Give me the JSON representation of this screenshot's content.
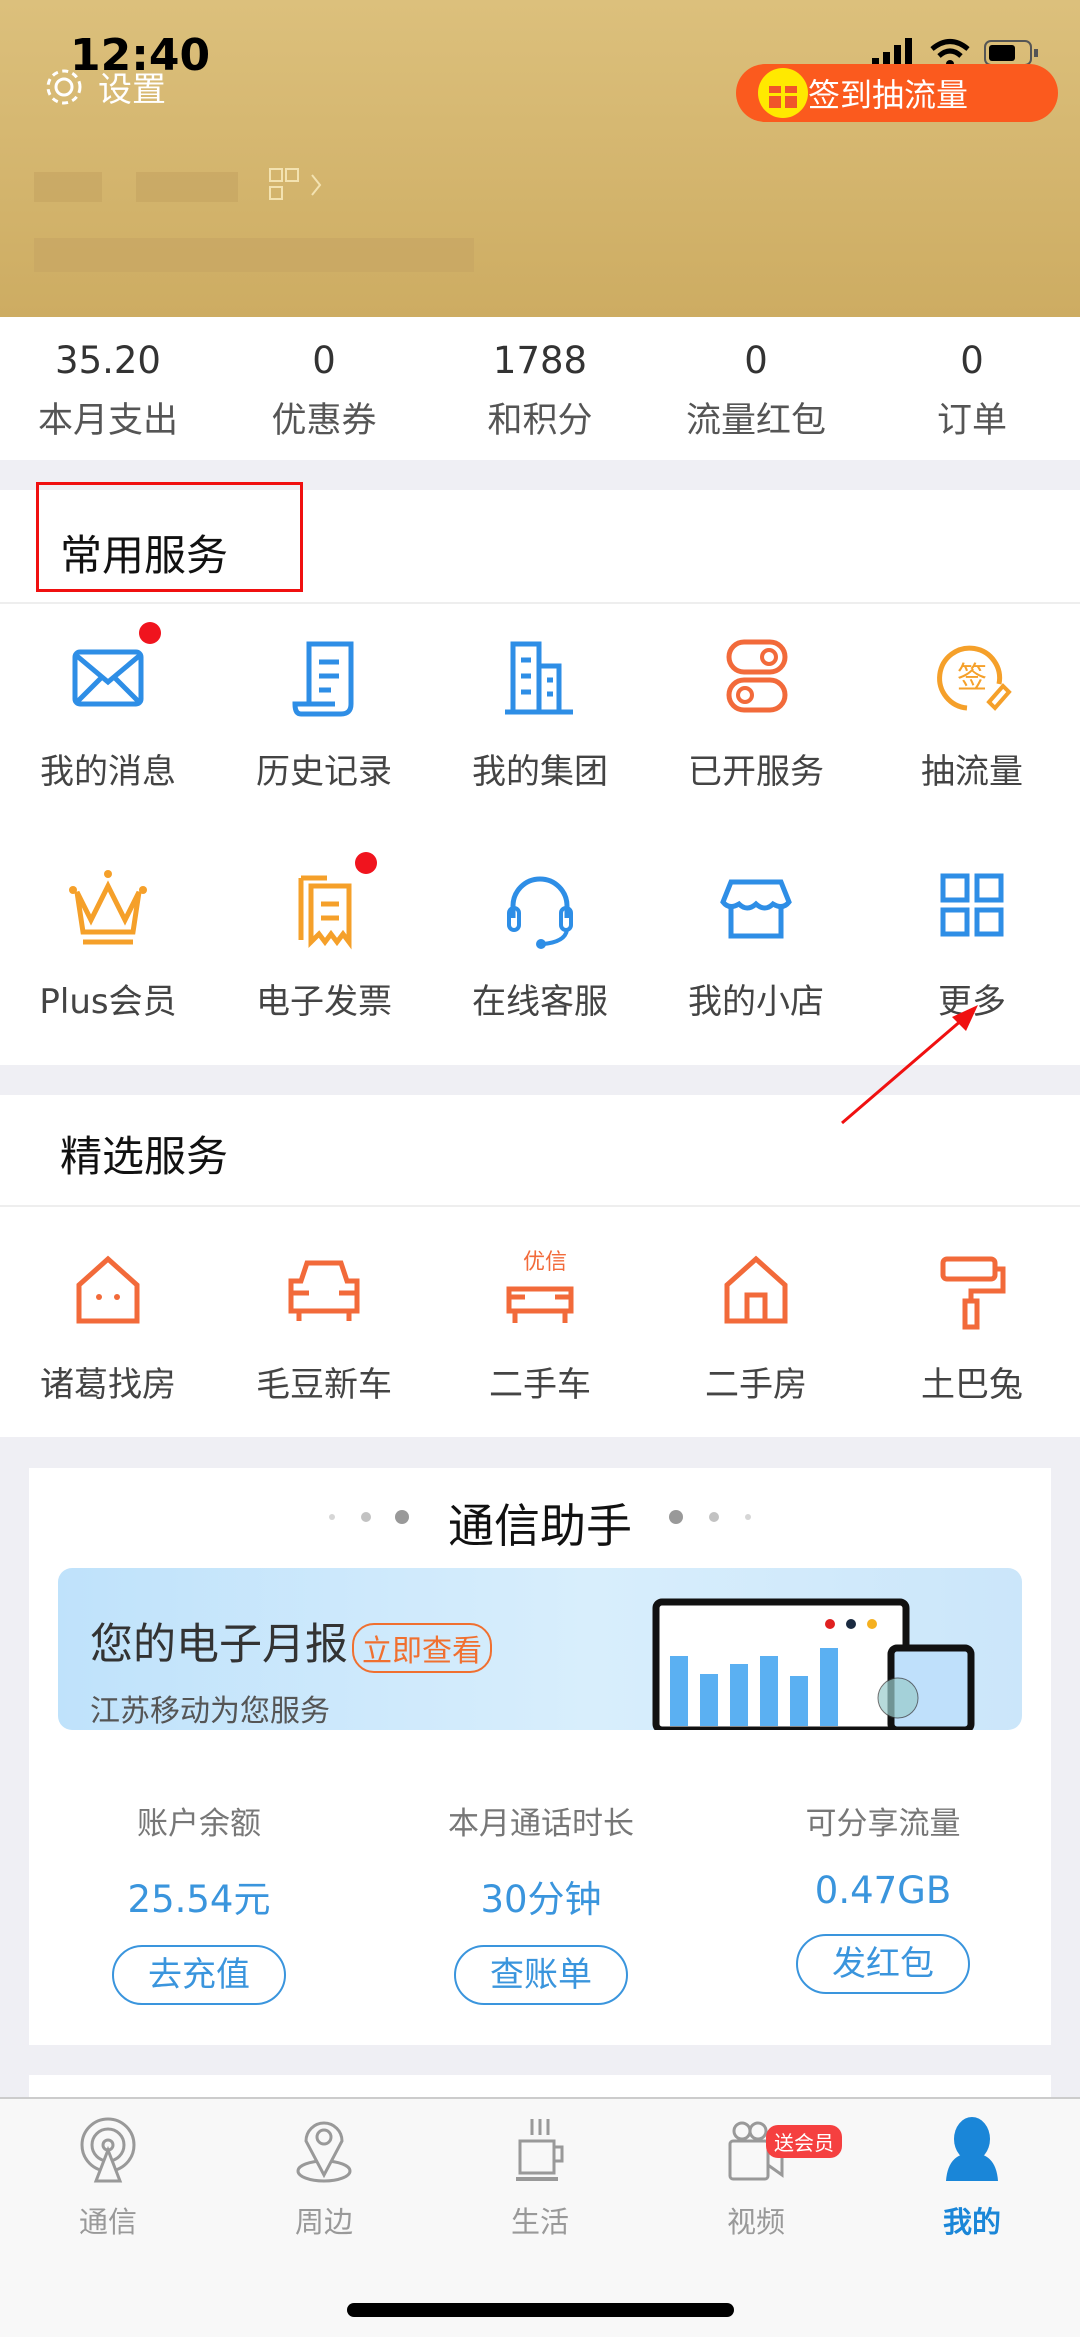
{
  "status_bar": {
    "time": "12:40"
  },
  "header": {
    "settings_label": "设置",
    "signin_label": "签到抽流量"
  },
  "stats": [
    {
      "value": "35.20",
      "label": "本月支出"
    },
    {
      "value": "0",
      "label": "优惠券"
    },
    {
      "value": "1788",
      "label": "和积分"
    },
    {
      "value": "0",
      "label": "流量红包"
    },
    {
      "value": "0",
      "label": "订单"
    }
  ],
  "common_services": {
    "title": "常用服务",
    "items": [
      {
        "label": "我的消息",
        "icon": "mail-icon",
        "badge": true
      },
      {
        "label": "历史记录",
        "icon": "scroll-icon"
      },
      {
        "label": "我的集团",
        "icon": "building-icon"
      },
      {
        "label": "已开服务",
        "icon": "toggle-icon"
      },
      {
        "label": "抽流量",
        "icon": "sign-icon"
      },
      {
        "label": "Plus会员",
        "icon": "crown-icon"
      },
      {
        "label": "电子发票",
        "icon": "invoice-icon",
        "badge": true
      },
      {
        "label": "在线客服",
        "icon": "headset-icon"
      },
      {
        "label": "我的小店",
        "icon": "shop-icon"
      },
      {
        "label": "更多",
        "icon": "grid-icon"
      }
    ]
  },
  "featured_services": {
    "title": "精选服务",
    "items": [
      {
        "label": "诸葛找房",
        "icon": "house-face-icon"
      },
      {
        "label": "毛豆新车",
        "icon": "car-icon"
      },
      {
        "label": "二手车",
        "icon": "used-car-icon",
        "icon_text": "优信"
      },
      {
        "label": "二手房",
        "icon": "house-icon"
      },
      {
        "label": "土巴兔",
        "icon": "paint-roller-icon"
      }
    ]
  },
  "assistant": {
    "title": "通信助手",
    "banner": {
      "title": "您的电子月报",
      "tag": "立即查看",
      "subtitle": "江苏移动为您服务"
    },
    "columns": [
      {
        "label": "账户余额",
        "value": "25.54元",
        "button": "去充值"
      },
      {
        "label": "本月通话时长",
        "value": "30分钟",
        "button": "查账单"
      },
      {
        "label": "可分享流量",
        "value": "0.47GB",
        "button": "发红包"
      }
    ]
  },
  "tabbar": {
    "active": 4,
    "items": [
      {
        "label": "通信",
        "icon": "antenna-icon"
      },
      {
        "label": "周边",
        "icon": "location-pin-icon"
      },
      {
        "label": "生活",
        "icon": "coffee-cup-icon"
      },
      {
        "label": "视频",
        "icon": "video-camera-icon",
        "badge": "送会员"
      },
      {
        "label": "我的",
        "icon": "user-icon"
      }
    ]
  },
  "colors": {
    "blue": "#2e8ee6",
    "orange": "#f5a02a",
    "red_orange": "#f26a3a",
    "header_gold": "#d6b870",
    "signin": "#fb5a1e",
    "active_tab": "#1a86d8"
  }
}
